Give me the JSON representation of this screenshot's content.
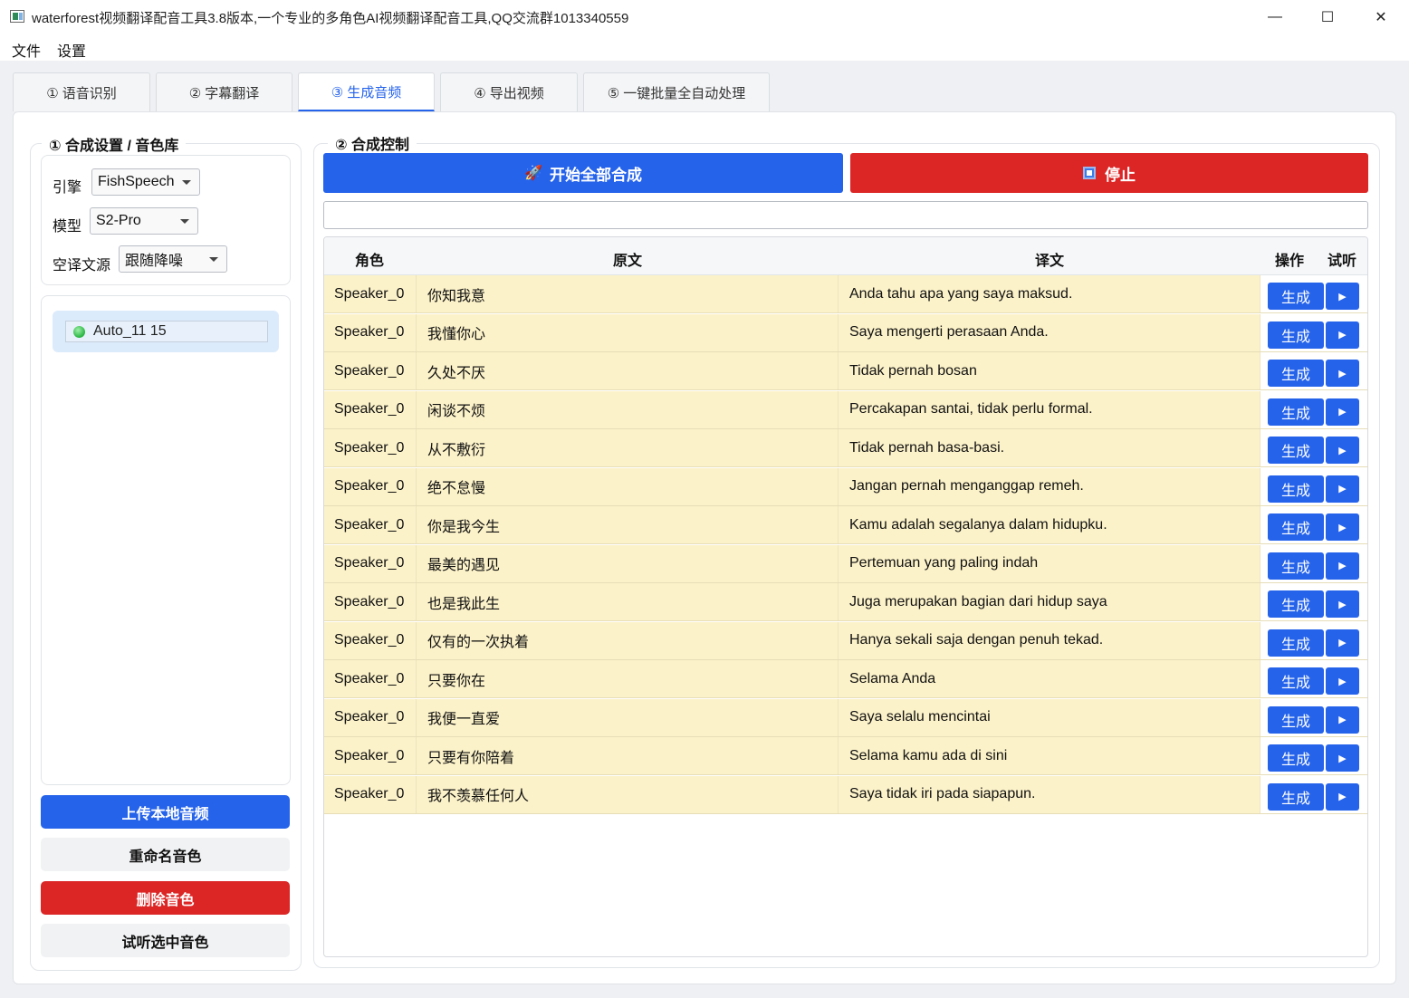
{
  "window": {
    "title": "waterforest视频翻译配音工具3.8版本,一个专业的多角色AI视频翻译配音工具,QQ交流群1013340559",
    "minimize": "—",
    "maximize": "☐",
    "close": "✕"
  },
  "menu": {
    "file": "文件",
    "settings": "设置"
  },
  "tabs": [
    {
      "label": "① 语音识别"
    },
    {
      "label": "② 字幕翻译"
    },
    {
      "label": "③ 生成音频",
      "active": true
    },
    {
      "label": "④ 导出视频"
    },
    {
      "label": "⑤ 一键批量全自动处理"
    }
  ],
  "left_panel": {
    "title": "① 合成设置 / 音色库",
    "engine_label": "引擎",
    "engine_value": "FishSpeech",
    "model_label": "模型",
    "model_value": "S2-Pro",
    "source_label": "空译文源",
    "source_value": "跟随降噪",
    "voices": [
      {
        "name": "Auto_11 15",
        "status_color": "#28b441"
      }
    ],
    "upload_button": "上传本地音频",
    "rename_button": "重命名音色",
    "delete_button": "删除音色",
    "preview_button": "试听选中音色"
  },
  "right_panel": {
    "title": "② 合成控制",
    "start_button": "开始全部合成",
    "start_icon": "rocket-icon",
    "stop_button": "停止",
    "stop_icon": "stop-square-icon",
    "progress_value": 0
  },
  "table": {
    "headers": {
      "role": "角色",
      "original": "原文",
      "translation": "译文",
      "ops": "操作",
      "listen": "试听"
    },
    "generate_label": "生成",
    "play_label": "▶",
    "rows": [
      {
        "role": "Speaker_0",
        "original": "你知我意",
        "translation": "Anda tahu apa yang saya maksud."
      },
      {
        "role": "Speaker_0",
        "original": "我懂你心",
        "translation": "Saya mengerti perasaan Anda."
      },
      {
        "role": "Speaker_0",
        "original": "久处不厌",
        "translation": "Tidak pernah bosan"
      },
      {
        "role": "Speaker_0",
        "original": "闲谈不烦",
        "translation": "Percakapan santai, tidak perlu formal."
      },
      {
        "role": "Speaker_0",
        "original": "从不敷衍",
        "translation": "Tidak pernah basa-basi."
      },
      {
        "role": "Speaker_0",
        "original": "绝不怠慢",
        "translation": "Jangan pernah menganggap remeh."
      },
      {
        "role": "Speaker_0",
        "original": "你是我今生",
        "translation": "Kamu adalah segalanya dalam hidupku."
      },
      {
        "role": "Speaker_0",
        "original": "最美的遇见",
        "translation": "Pertemuan yang paling indah"
      },
      {
        "role": "Speaker_0",
        "original": "也是我此生",
        "translation": "Juga merupakan bagian dari hidup saya"
      },
      {
        "role": "Speaker_0",
        "original": "仅有的一次执着",
        "translation": "Hanya sekali saja dengan penuh tekad."
      },
      {
        "role": "Speaker_0",
        "original": "只要你在",
        "translation": "Selama Anda"
      },
      {
        "role": "Speaker_0",
        "original": "我便一直爱",
        "translation": "Saya selalu mencintai"
      },
      {
        "role": "Speaker_0",
        "original": "只要有你陪着",
        "translation": "Selama kamu ada di sini"
      },
      {
        "role": "Speaker_0",
        "original": "我不羡慕任何人",
        "translation": "Saya tidak iri pada siapapun."
      }
    ]
  }
}
